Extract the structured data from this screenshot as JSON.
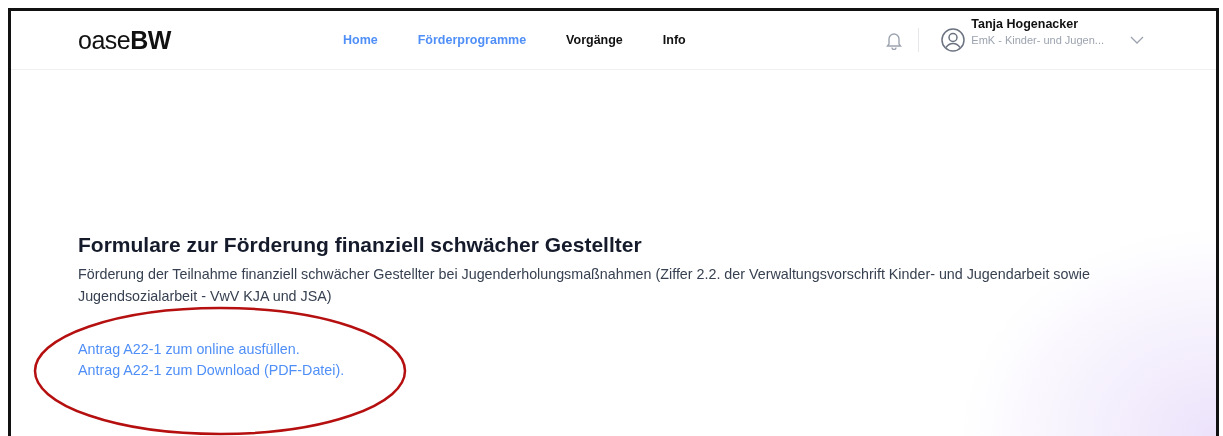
{
  "header": {
    "logo": "oase**BW**",
    "nav": [
      {
        "label": "Home",
        "selected": true
      },
      {
        "label": "Förderprogramme",
        "selected": true
      },
      {
        "label": "Vorgänge",
        "selected": false
      },
      {
        "label": "Info",
        "selected": false
      }
    ],
    "user": {
      "name": "Tanja Hogenacker",
      "organisation": "EmK - Kinder- und Jugen..."
    }
  },
  "content": {
    "title": "Formulare zur Förderung finanziell schwächer Gestellter",
    "description": "Förderung der Teilnahme finanziell schwächer Gestellter bei Jugenderholungsmaßnahmen (Ziffer 2.2. der Verwaltungsvorschrift Kinder- und Jugendarbeit sowie Jugendsozialarbeit - VwV KJA und JSA)",
    "links": [
      "Antrag A22-1 zum online ausfüllen.",
      "Antrag A22-1 zum Download (PDF-Datei)."
    ]
  }
}
